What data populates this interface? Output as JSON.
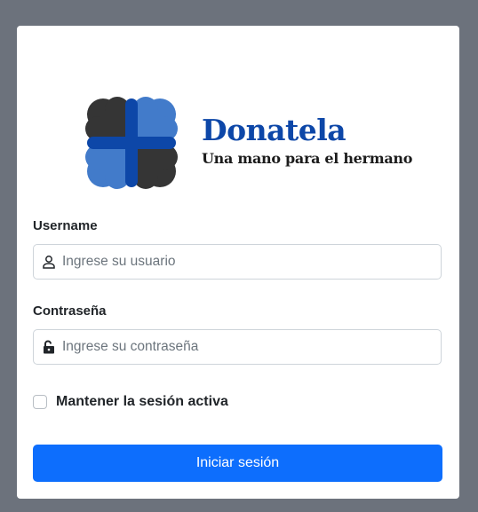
{
  "brand": {
    "name": "Donatela",
    "tagline": "Una mano para el hermano"
  },
  "form": {
    "username_label": "Username",
    "username_placeholder": "Ingrese su usuario",
    "username_icon": "user-icon",
    "password_label": "Contraseña",
    "password_placeholder": "Ingrese su contraseña",
    "password_icon": "lock-open-icon",
    "remember_label": "Mantener la sesión activa",
    "remember_checked": false,
    "submit_label": "Iniciar sesión"
  },
  "colors": {
    "primary": "#0d6efd",
    "brand_blue": "#0d47a8",
    "background": "#6c727c"
  }
}
